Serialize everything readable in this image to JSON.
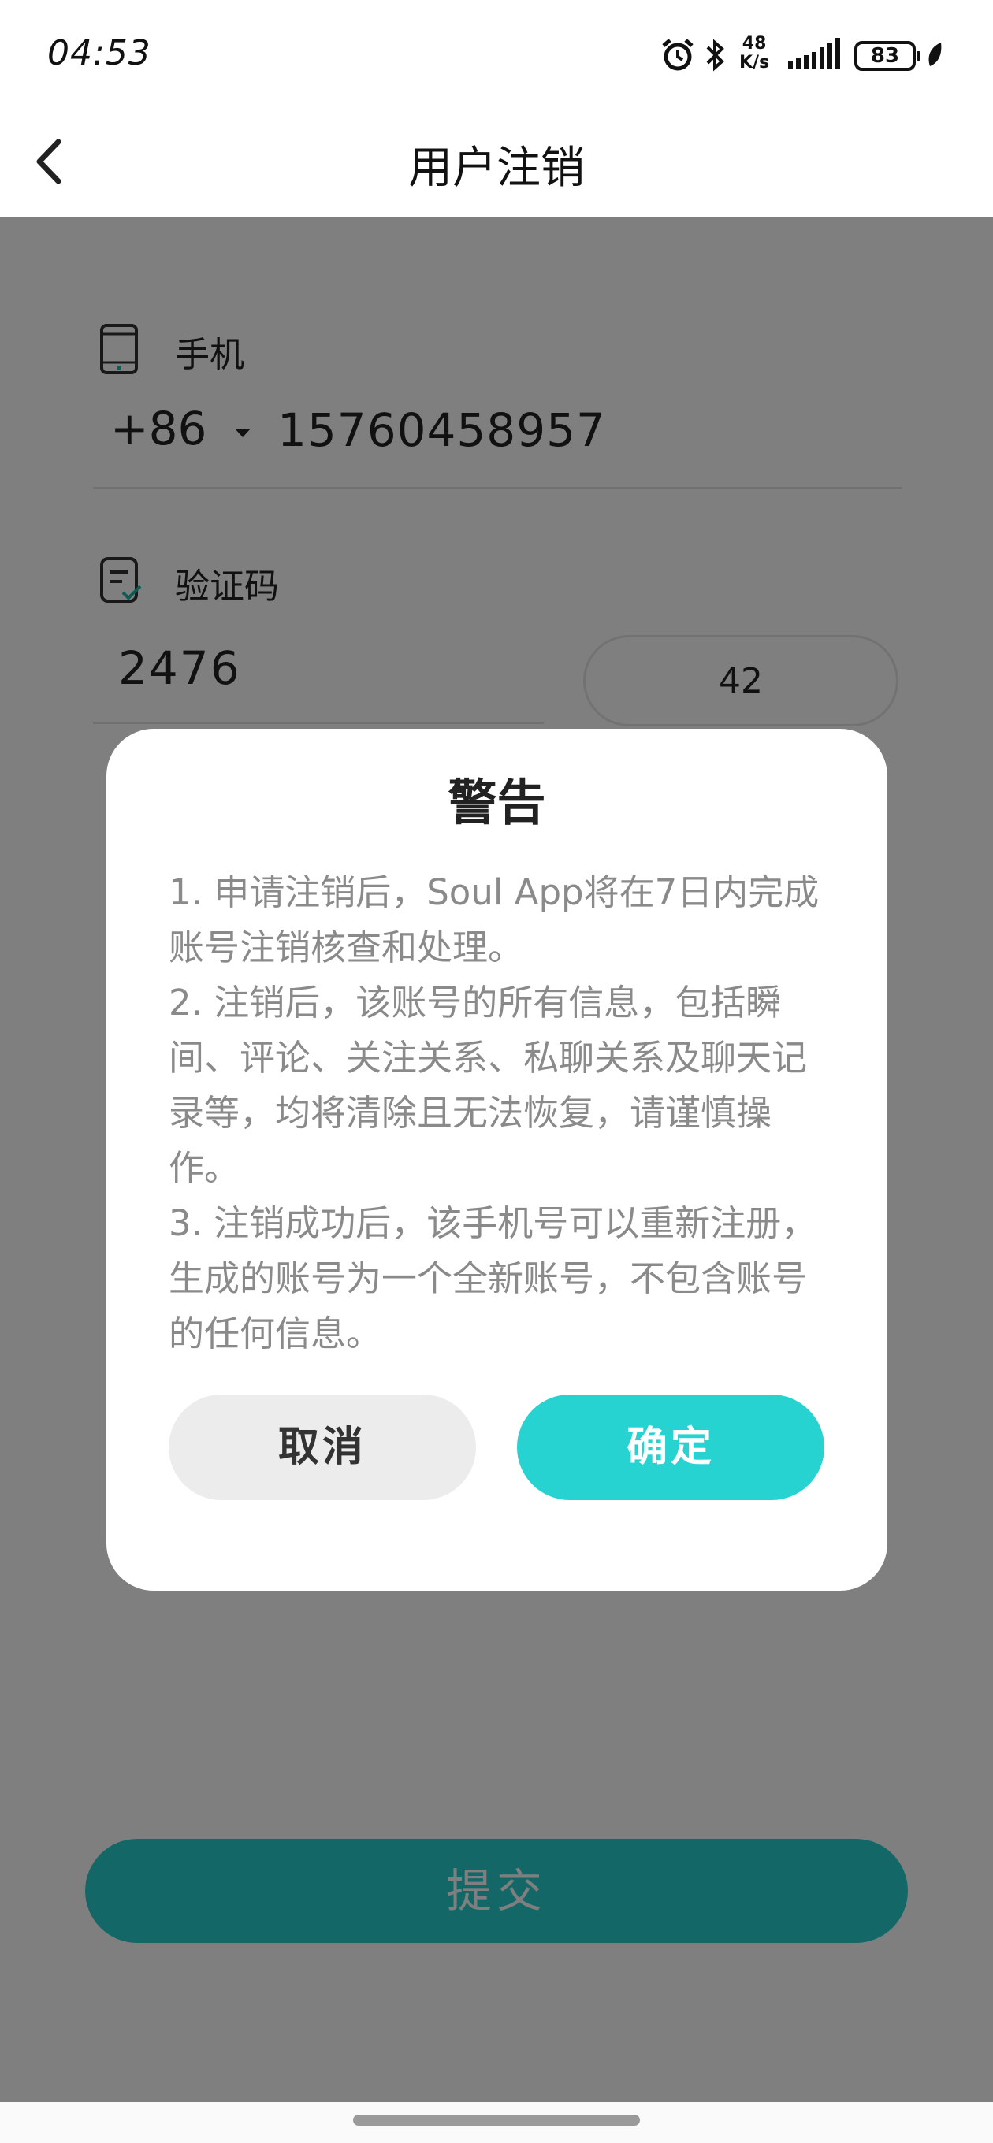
{
  "status_bar": {
    "time": "04:53",
    "net_speed_value": "48",
    "net_speed_unit": "K/s",
    "battery": "83",
    "icons": [
      "alarm-icon",
      "bluetooth-icon",
      "signal-icon",
      "battery-icon",
      "leaf-icon"
    ]
  },
  "header": {
    "title": "用户注销",
    "back_icon": "chevron-left-icon"
  },
  "form": {
    "phone_label": "手机",
    "country_code": "+86",
    "phone_value": "15760458957",
    "code_label": "验证码",
    "code_value": "2476",
    "countdown": "42",
    "submit_label": "提交"
  },
  "dialog": {
    "title": "警告",
    "items": [
      "1. 申请注销后，Soul App将在7日内完成账号注销核查和处理。",
      "2. 注销后，该账号的所有信息，包括瞬间、评论、关注关系、私聊关系及聊天记录等，均将清除且无法恢复，请谨慎操作。",
      "3. 注销成功后，该手机号可以重新注册，生成的账号为一个全新账号，不包含账号的任何信息。"
    ],
    "cancel_label": "取消",
    "confirm_label": "确定"
  },
  "colors": {
    "accent": "#26d3d0",
    "overlay": "rgba(0,0,0,0.5)",
    "body_text": "#8a8a8a"
  }
}
